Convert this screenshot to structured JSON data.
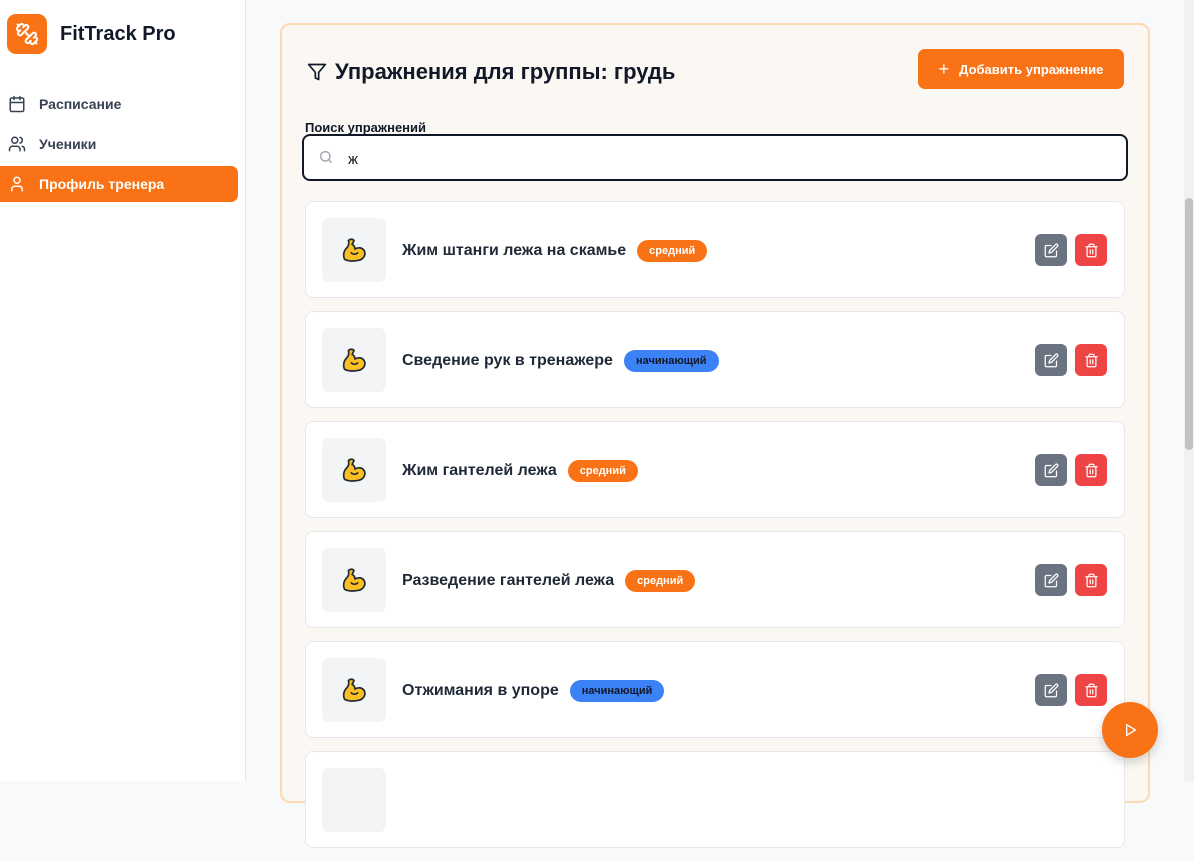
{
  "app": {
    "name": "FitTrack Pro"
  },
  "sidebar": {
    "items": [
      {
        "label": "Расписание",
        "icon": "calendar-icon",
        "active": false
      },
      {
        "label": "Ученики",
        "icon": "users-icon",
        "active": false
      },
      {
        "label": "Профиль тренера",
        "icon": "user-icon",
        "active": true
      }
    ]
  },
  "panel": {
    "title": "Упражнения для группы: грудь",
    "add_button": "Добавить упражнение",
    "search": {
      "label": "Поиск упражнений",
      "value": "ж",
      "placeholder": ""
    }
  },
  "exercises": [
    {
      "name": "Жим штанги лежа на скамье",
      "level": "средний",
      "level_color": "#f97316"
    },
    {
      "name": "Сведение рук в тренажере",
      "level": "начинающий",
      "level_color": "#3b82f6"
    },
    {
      "name": "Жим гантелей лежа",
      "level": "средний",
      "level_color": "#f97316"
    },
    {
      "name": "Разведение гантелей лежа",
      "level": "средний",
      "level_color": "#f97316"
    },
    {
      "name": "Отжимания в упоре",
      "level": "начинающий",
      "level_color": "#3b82f6"
    }
  ],
  "colors": {
    "accent": "#f97316",
    "danger": "#ef4444",
    "neutral_button": "#6b7280",
    "beginner": "#3b82f6"
  }
}
